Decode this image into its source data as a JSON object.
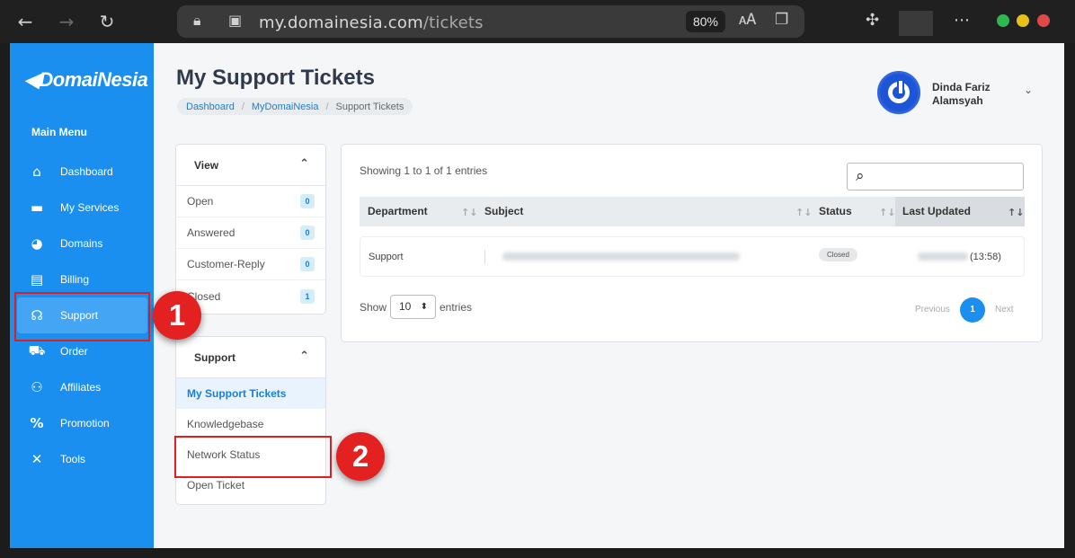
{
  "browser": {
    "url_host": "my.domainesia.com",
    "url_path": "/tickets",
    "zoom": "80%"
  },
  "sidebar": {
    "logo": "DomaiNesia",
    "menu_title": "Main Menu",
    "items": [
      {
        "label": "Dashboard",
        "icon": "home-icon"
      },
      {
        "label": "My Services",
        "icon": "server-icon"
      },
      {
        "label": "Domains",
        "icon": "globe-icon"
      },
      {
        "label": "Billing",
        "icon": "receipt-icon"
      },
      {
        "label": "Support",
        "icon": "headset-icon"
      },
      {
        "label": "Order",
        "icon": "cart-icon"
      },
      {
        "label": "Affiliates",
        "icon": "handshake-icon"
      },
      {
        "label": "Promotion",
        "icon": "percent-icon"
      },
      {
        "label": "Tools",
        "icon": "tools-icon"
      }
    ]
  },
  "header": {
    "title": "My Support Tickets",
    "breadcrumb": [
      "Dashboard",
      "MyDomaiNesia",
      "Support Tickets"
    ]
  },
  "user": {
    "name": "Dinda Fariz Alamsyah"
  },
  "view_panel": {
    "title": "View",
    "items": [
      {
        "label": "Open",
        "count": "0"
      },
      {
        "label": "Answered",
        "count": "0"
      },
      {
        "label": "Customer-Reply",
        "count": "0"
      },
      {
        "label": "Closed",
        "count": "1"
      }
    ]
  },
  "support_panel": {
    "title": "Support",
    "items": [
      "My Support Tickets",
      "Knowledgebase",
      "Network Status",
      "Open Ticket"
    ]
  },
  "tickets": {
    "info": "Showing 1 to 1 of 1 entries",
    "columns": [
      "Department",
      "Subject",
      "Status",
      "Last Updated"
    ],
    "rows": [
      {
        "department": "Support",
        "status": "Closed",
        "time": "(13:58)"
      }
    ],
    "show_label": "Show",
    "page_size": "10",
    "entries_label": "entries",
    "prev": "Previous",
    "page": "1",
    "next": "Next"
  },
  "annotations": {
    "marker_1": "1",
    "marker_2": "2",
    "color": "#e01e1e"
  }
}
